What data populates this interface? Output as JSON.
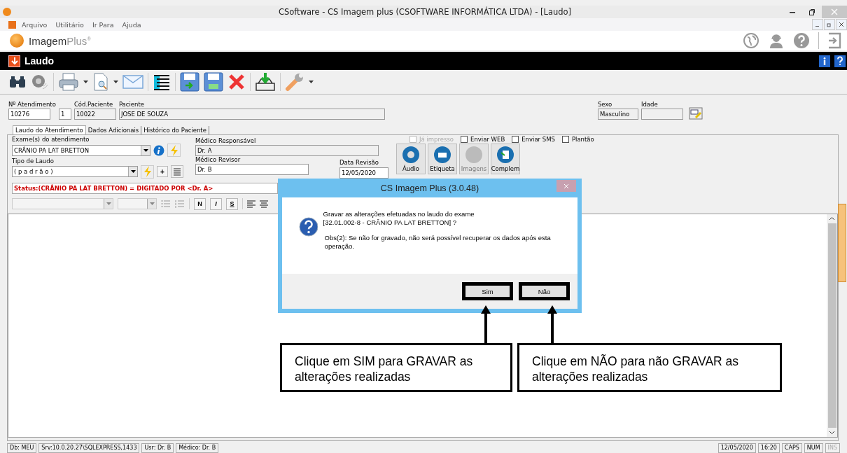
{
  "window": {
    "title": "CSoftware - CS Imagem plus (CSOFTWARE INFORMÁTICA LTDA) - [Laudo]"
  },
  "menu": [
    "Arquivo",
    "Utilitário",
    "Ir Para",
    "Ajuda"
  ],
  "brand": {
    "name": "Imagem",
    "suffix": "Plus",
    "mark": "®"
  },
  "module_title": "Laudo",
  "patient_fields": [
    {
      "label": "Nº Atendimento",
      "value": "10276"
    },
    {
      "value": "1"
    },
    {
      "label": "Cód.Paciente",
      "value": "10022"
    },
    {
      "label": "Paciente",
      "value": "JOSE DE SOUZA"
    },
    {
      "label": "Sexo",
      "value": "Masculino"
    },
    {
      "label": "Idade"
    }
  ],
  "tabs": [
    {
      "label": "Laudo do Atendimento",
      "selected": true
    },
    {
      "label": "Dados Adicionais",
      "selected": false
    },
    {
      "label": "Histórico do Paciente",
      "selected": false
    }
  ],
  "form": {
    "exam": {
      "label": "Exame(s) do atendimento",
      "value": "CRÂNIO PA LAT BRETTON"
    },
    "medico_responsavel": {
      "label": "Médico Responsável",
      "value": "Dr. A"
    },
    "tipo_laudo": {
      "label": "Tipo de Laudo",
      "value": "( p a d r ã o )"
    },
    "medico_revisor": {
      "label": "Médico Revisor",
      "value": "Dr. B"
    },
    "data_revisao": {
      "label": "Data Revisão",
      "value": "12/05/2020"
    },
    "add_button": "+",
    "checkboxes": [
      {
        "label": "Já impresso",
        "checked": false,
        "disabled": true
      },
      {
        "label": "Enviar WEB",
        "checked": false,
        "disabled": false
      },
      {
        "label": "Enviar SMS",
        "checked": false,
        "disabled": false
      },
      {
        "label": "Plantão",
        "checked": false,
        "disabled": false
      }
    ],
    "actions": [
      {
        "label": "Áudio",
        "kind": "audio",
        "disabled": false
      },
      {
        "label": "Etiqueta",
        "kind": "print",
        "disabled": false
      },
      {
        "label": "Imagens",
        "kind": "images",
        "disabled": true
      },
      {
        "label": "Complem",
        "kind": "doc",
        "disabled": false
      }
    ],
    "status_text": "Status:(CRÂNIO PA LAT BRETTON) = DIGITADO POR <Dr. A>",
    "format_buttons": [
      "N",
      "I",
      "S"
    ]
  },
  "dialog": {
    "title": "CS Imagem Plus (3.0.48)",
    "message": [
      "Gravar as alterações efetuadas no laudo do exame",
      "[32.01.002-8 - CRÂNIO PA LAT BRETTON] ?"
    ],
    "note": "Obs(2): Se não for gravado, não será possível recuperar os dados após esta operação.",
    "buttons": [
      "Sim",
      "Não"
    ]
  },
  "callouts": [
    "Clique em SIM para GRAVAR as alterações realizadas",
    "Clique em NÃO para não GRAVAR as alterações realizadas"
  ],
  "status_bar": [
    {
      "text": "Db: MEU",
      "disabled": false
    },
    {
      "text": "Srv:10.0.20.27\\SQLEXPRESS,1433",
      "disabled": false
    },
    {
      "text": "Usr: Dr. B",
      "disabled": false
    },
    {
      "text": "Médico: Dr. B",
      "disabled": false
    },
    {
      "text": "12/05/2020",
      "disabled": false
    },
    {
      "text": "16:20",
      "disabled": false
    },
    {
      "text": "CAPS",
      "disabled": false
    },
    {
      "text": "NUM",
      "disabled": false
    },
    {
      "text": "INS",
      "disabled": true
    }
  ]
}
